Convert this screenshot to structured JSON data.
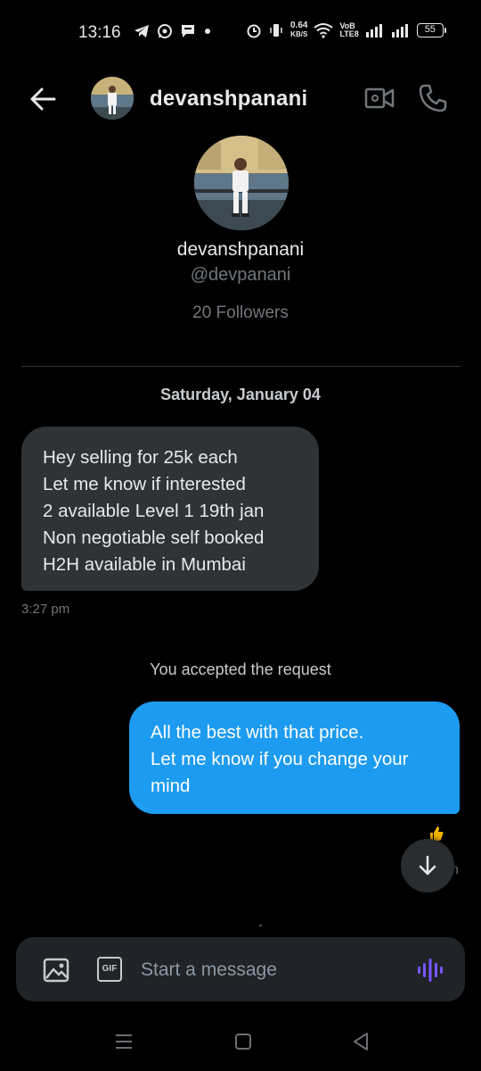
{
  "status_bar": {
    "time": "13:16",
    "net_speed_value": "0.64",
    "net_speed_unit": "KB/S",
    "network_label_top": "VoB",
    "network_label_bottom": "LTE8",
    "battery": "55"
  },
  "header": {
    "username": "devanshpanani"
  },
  "profile": {
    "name": "devanshpanani",
    "handle": "@devpanani",
    "followers": "20 Followers"
  },
  "conversation": {
    "date_separator": "Saturday, January 04",
    "incoming": {
      "lines": [
        "Hey selling for 25k each",
        "Let me know if interested",
        "2 available Level 1 19th jan",
        "Non negotiable self booked",
        "H2H available in Mumbai"
      ],
      "time": "3:27 pm"
    },
    "system_message": "You accepted the request",
    "outgoing": {
      "lines": [
        "All the best with that price.",
        "Let me know if you change your",
        "mind"
      ]
    },
    "partial_time_char": "n"
  },
  "composer": {
    "gif_label": "GIF",
    "placeholder": "Start a message"
  },
  "colors": {
    "accent": "#1d9bf0",
    "incoming_bubble": "#2f3336",
    "voice_icon": "#7856ff"
  }
}
